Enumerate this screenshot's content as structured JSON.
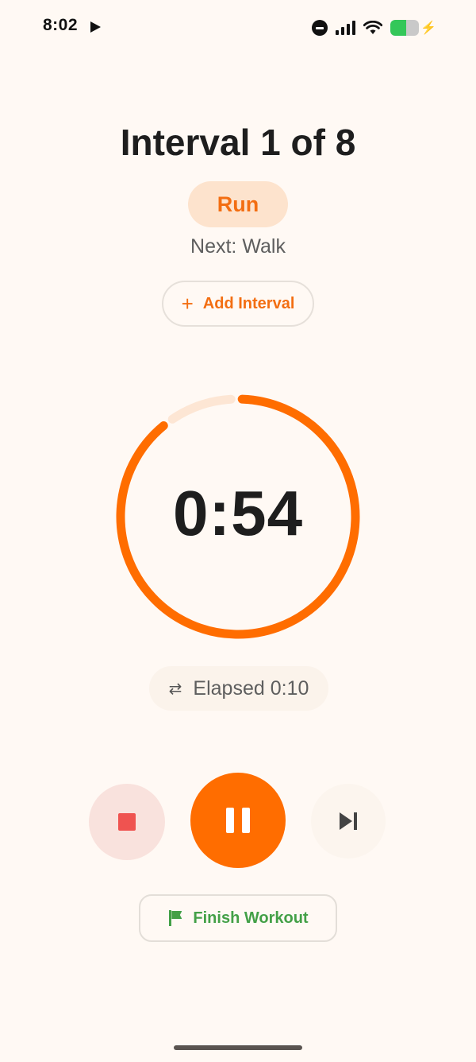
{
  "status_bar": {
    "time": "8:02",
    "battery_fraction": 0.55,
    "battery_color": "#34C759",
    "icons": [
      "play-icon",
      "dnd-icon",
      "signal-icon",
      "wifi-icon",
      "battery-icon",
      "bolt-icon"
    ]
  },
  "header": {
    "title": "Interval 1 of 8",
    "phase": "Run",
    "next_label": "Next: Walk"
  },
  "add_interval": {
    "icon": "plus-icon",
    "label": "Add Interval"
  },
  "timer": {
    "remaining": "0:54",
    "progress_remaining_fraction": 0.9,
    "accent_color": "#FF6D00",
    "track_color": "#FDE6D4"
  },
  "elapsed": {
    "icon": "swap-arrows-icon",
    "label": "Elapsed 0:10"
  },
  "controls": {
    "stop_icon": "stop-icon",
    "pause_icon": "pause-icon",
    "skip_icon": "skip-next-icon"
  },
  "finish": {
    "icon": "flag-icon",
    "label": "Finish Workout",
    "color": "#43A047"
  },
  "colors": {
    "background": "#FFF9F4",
    "accent": "#FF6D00",
    "accent_text": "#F36E12",
    "stop": "#EF5350"
  }
}
